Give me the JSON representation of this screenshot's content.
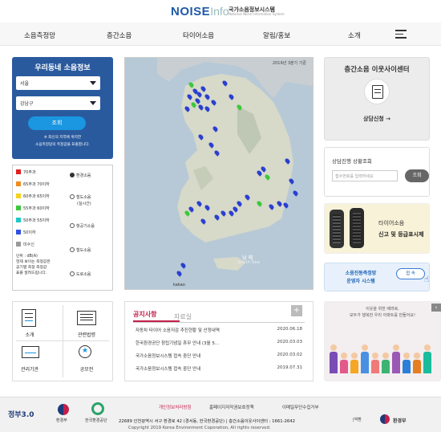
{
  "header": {
    "logo_word": "NOISE",
    "logo_info": "Info",
    "logo_kr": "국가소음정보시스템",
    "logo_en": "National Noise Information System"
  },
  "nav": {
    "items": [
      "소음측정망",
      "층간소음",
      "타이어소음",
      "알림/홍보",
      "소개"
    ]
  },
  "left": {
    "title": "우리동네 소음정보",
    "city": "서울",
    "district": "강남구",
    "query": "조회",
    "note1": "※ 최신의 지역에 위치한",
    "note2": "소음측정망의 측정값을 표출합니다.",
    "legend": [
      "70주과",
      "65주과 70이하",
      "60주과 65이하",
      "55주과 60이하",
      "50주과 55이하",
      "50이하",
      "미수신"
    ],
    "legend_colors": [
      "#e02020",
      "#f08c1e",
      "#f5d21e",
      "#3cc83c",
      "#1ec8c8",
      "#3050e0",
      "#999999"
    ],
    "radio": [
      "환경소음",
      "철도소음",
      "(실시간)",
      "항공기소음",
      "철도소음",
      "도로소음"
    ],
    "unit1": "단위 : dB(A)",
    "unit2": "현재 보이는 측정값은",
    "unit3": "공기별 측정 측정값",
    "unit4": "표를 알려드립니다."
  },
  "map": {
    "year": "2019년 3분기 기준",
    "sea_kr": "남 해",
    "sea_en": "South Sea",
    "kakao": "kakao"
  },
  "right": {
    "center_title": "층간소음 이웃사이센터",
    "consult": "상담신청 →",
    "status_title": "상담진행 상황조회",
    "status_placeholder": "접수번호를 입력하세요",
    "status_btn": "조회",
    "tire1": "타이어소음",
    "tire2": "신고 및 등급표시제",
    "sys1": "소음진동측정망",
    "sys2": "운영자 시스템",
    "sys_btn": "접 속",
    "banner1": "이웃을 위한 배려로,",
    "banner2": "모두가 행복한 우리 아파트를 만들어요!"
  },
  "quick": {
    "items": [
      "소개",
      "관련법령",
      "관리기관",
      "공모전"
    ]
  },
  "notice": {
    "tab1": "공지사항",
    "tab2": "자료실",
    "plus": "+",
    "rows": [
      {
        "title": "자동차 타이어 소음저감 추진현황 및 산정내역",
        "date": "2020.06.18"
      },
      {
        "title": "한국환경공단 창립기념일 휴무 안내 (3월 5...",
        "date": "2020.03.03"
      },
      {
        "title": "국가소음정보시스템 접속 중단 안내",
        "date": "2020.03.02"
      },
      {
        "title": "국가소음정보시스템 접속 중단 안내",
        "date": "2019.07.31"
      }
    ]
  },
  "footer": {
    "links": [
      "개인정보처리방침",
      "홈페이지저작권보호정책",
      "이메일무단수집거부"
    ],
    "address": "22689 인천광역시 서구 환경로 42 (경서동, 한국환경공단) | 층간소음이웃사이센터 : 1661-2642",
    "copyright": "Copyright 2019 Korea Environment Coporation, All rights reserved.",
    "gov30": "정부3.0",
    "moe": "환경부",
    "keco": "한국환경공단",
    "moe2": "환경부",
    "me_label": "|약환"
  }
}
